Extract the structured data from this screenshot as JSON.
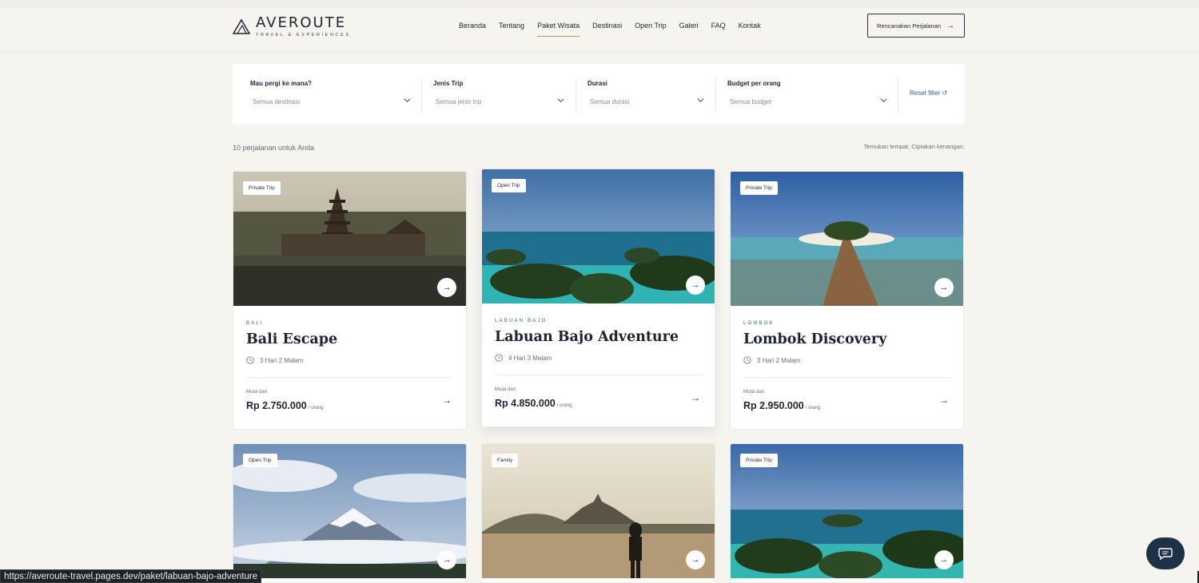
{
  "brand": {
    "name": "AVEROUTE",
    "sub": "TRAVEL & EXPERIENCES"
  },
  "nav": {
    "items": [
      "Beranda",
      "Tentang",
      "Paket Wisata",
      "Destinasi",
      "Open Trip",
      "Galeri",
      "FAQ",
      "Kontak"
    ],
    "active": "Paket Wisata"
  },
  "header": {
    "cta_label": "Rencanakan Perjalanan"
  },
  "filters": {
    "destination": {
      "label": "Mau pergi ke mana?",
      "value": "Semua destinasi"
    },
    "trip_type": {
      "label": "Jenis Trip",
      "value": "Semua jenis trip"
    },
    "duration": {
      "label": "Durasi",
      "value": "Semua durasi"
    },
    "budget": {
      "label": "Budget per orang",
      "value": "Semua budget"
    },
    "reset_label": "Reset filter ↺"
  },
  "results": {
    "count_text": "10 perjalanan untuk Anda",
    "tagline": "Temukan tempat. Ciptakan kenangan."
  },
  "cards": [
    {
      "badge": "Private Trip",
      "destination": "BALI",
      "title": "Bali Escape",
      "duration": "3 Hari 2 Malam",
      "from_label": "Mulai dari",
      "price": "Rp 2.750.000",
      "per": "/ orang"
    },
    {
      "badge": "Open Trip",
      "destination": "LABUAN BAJO",
      "title": "Labuan Bajo Adventure",
      "duration": "4 Hari 3 Malam",
      "from_label": "Mulai dari",
      "price": "Rp 4.850.000",
      "per": "/ orang"
    },
    {
      "badge": "Private Trip",
      "destination": "LOMBOK",
      "title": "Lombok Discovery",
      "duration": "3 Hari 2 Malam",
      "from_label": "Mulai dari",
      "price": "Rp 2.950.000",
      "per": "/ orang"
    },
    {
      "badge": "Open Trip"
    },
    {
      "badge": "Family"
    },
    {
      "badge": "Private Trip"
    }
  ],
  "status_url": "https://averoute-travel.pages.dev/paket/labuan-bajo-adventure",
  "colors": {
    "accent": "#2e5f8a",
    "active_underline": "#b89763",
    "chat_bg": "#1f3147",
    "page_bg": "#f5f4ef"
  },
  "icons": {
    "logo": "mountain-logo-icon",
    "arrow": "arrow-right-icon",
    "chevron": "chevron-down-icon",
    "clock": "clock-icon",
    "chat": "chat-bubble-icon"
  }
}
